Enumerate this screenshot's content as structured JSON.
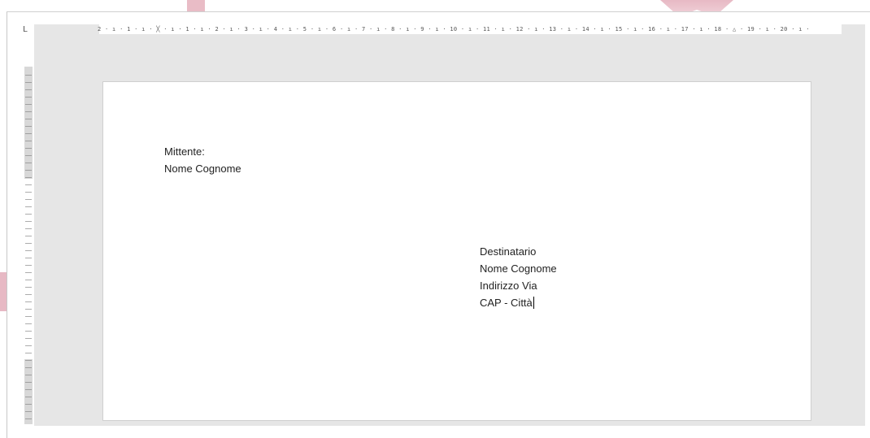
{
  "ruler": {
    "corner_symbol": "L",
    "horizontal_ticks": "2 · ı · 1 · ı · ╳ · ı · 1 · ı · 2 · ı · 3 · ı · 4 · ı · 5 · ı · 6 · ı · 7 · ı · 8 · ı · 9 · ı · 10 · ı · 11 · ı · 12 · ı · 13 · ı · 14 · ı · 15 · ı · 16 · ı · 17 · ı · 18 · △ · 19 · ı · 20 · ı ·"
  },
  "document": {
    "sender_label": "Mittente:",
    "sender_name": "Nome Cognome",
    "recipient_label": "Destinatario",
    "recipient_name": "Nome Cognome",
    "recipient_address": "Indirizzo Via",
    "recipient_city": "CAP - Città"
  },
  "colors": {
    "workspace": "#e6e6e6",
    "page": "#ffffff",
    "watermark": "#e7b9c4"
  }
}
